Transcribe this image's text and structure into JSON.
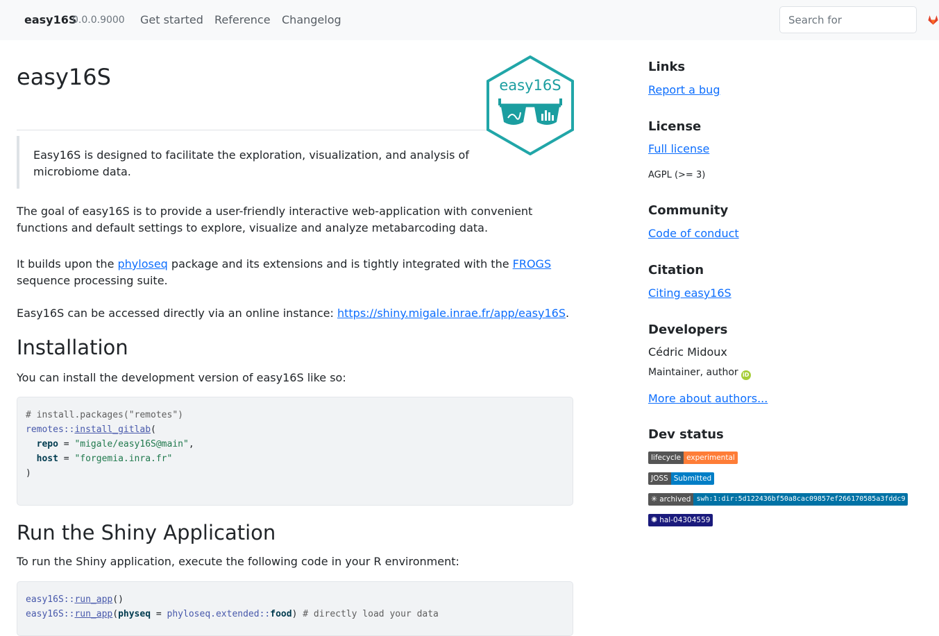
{
  "navbar": {
    "brand": "easy16S",
    "version": "0.0.0.9000",
    "links": [
      "Get started",
      "Reference",
      "Changelog"
    ],
    "search_placeholder": "Search for",
    "gitlab_icon": "gitlab-icon"
  },
  "main": {
    "title": "easy16S",
    "logo": {
      "text": "easy16S",
      "colors": {
        "teal": "#1b9ea0",
        "border": "#21a6a8"
      }
    },
    "quote": "Easy16S is designed to facilitate the exploration, visualization, and analysis of microbiome data.",
    "para1": "The goal of easy16S is to provide a user-friendly interactive web-application with convenient functions and default settings to explore, visualize and analyze metabarcoding data.",
    "para2": {
      "before": "It builds upon the ",
      "link1": "phyloseq",
      "middle": " package and its extensions and is tightly integrated with the ",
      "link2": "FROGS",
      "after": " sequence processing suite."
    },
    "para3": {
      "before": "Easy16S can be accessed directly via an online instance: ",
      "link": "https://shiny.migale.inrae.fr/app/easy16S",
      "after": "."
    },
    "install": {
      "heading": "Installation",
      "text": "You can install the development version of easy16S like so:",
      "code": {
        "l1": "# install.packages(\"remotes\")",
        "l2_ns": "remotes::",
        "l2_fn": "install_gitlab",
        "l2_end": "(",
        "l3_kw": "repo",
        "l3_eq": " = ",
        "l3_str": "\"migale/easy16S@main\"",
        "l3_end": ",",
        "l4_kw": "host",
        "l4_eq": " = ",
        "l4_str": "\"forgemia.inra.fr\"",
        "l5": ")"
      }
    },
    "run": {
      "heading": "Run the Shiny Application",
      "text": "To run the Shiny application, execute the following code in your R environment:",
      "code": {
        "l1_ns": "easy16S::",
        "l1_fn": "run_app",
        "l1_end": "()",
        "l2_ns": "easy16S::",
        "l2_fn": "run_app",
        "l2_open": "(",
        "l2_kw": "physeq",
        "l2_eq": " = ",
        "l2_ns2": "phyloseq.extended::",
        "l2_kw2": "food",
        "l2_close": ") ",
        "l2_comment": "# directly load your data"
      }
    }
  },
  "sidebar": {
    "links_heading": "Links",
    "report_bug": "Report a bug",
    "license_heading": "License",
    "full_license": "Full license",
    "license_text": "AGPL (>= 3)",
    "community_heading": "Community",
    "code_of_conduct": "Code of conduct",
    "citation_heading": "Citation",
    "citing": "Citing easy16S",
    "developers_heading": "Developers",
    "dev_name": "Cédric Midoux",
    "dev_role": "Maintainer, author",
    "more_authors": "More about authors...",
    "dev_status_heading": "Dev status",
    "badges": {
      "lifecycle": {
        "label": "lifecycle",
        "value": "experimental",
        "color": "#fe7d37"
      },
      "joss": {
        "label": "JOSS",
        "value": "Submitted",
        "color": "#007ec6"
      },
      "swh": {
        "label": "archived",
        "value": "swh:1:dir:5d122436bf50a8cac09857ef266170585a3fddc9",
        "color": "#0072a5"
      },
      "hal": {
        "value": "hal-04304559",
        "color": "#1a1a7c"
      }
    }
  }
}
